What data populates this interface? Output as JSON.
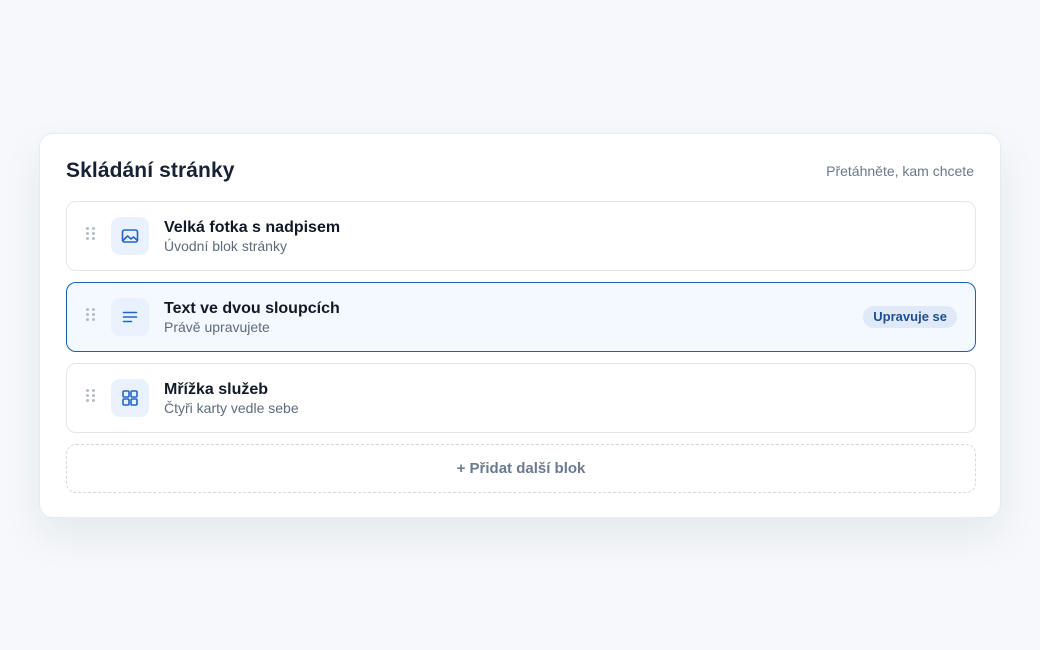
{
  "builder": {
    "title": "Skládání stránky",
    "hint": "Přetáhněte, kam chcete",
    "blocks": [
      {
        "title": "Velká fotka s nadpisem",
        "subtitle": "Úvodní blok stránky",
        "icon": "image-icon"
      },
      {
        "title": "Text ve dvou sloupcích",
        "subtitle": "Právě upravujete",
        "icon": "text-lines-icon",
        "badge": "Upravuje se"
      },
      {
        "title": "Mřížka služeb",
        "subtitle": "Čtyři karty vedle sebe",
        "icon": "grid-icon"
      }
    ],
    "add_label": "+ Přidat další blok"
  },
  "colors": {
    "accent": "#1f5fb0",
    "icon": "#2563c9",
    "background": "#f6f8fb"
  }
}
